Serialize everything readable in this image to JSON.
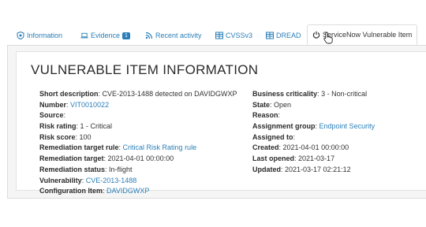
{
  "tabs": [
    {
      "label": "Information",
      "icon": "shield-bug-icon"
    },
    {
      "label": "Evidence",
      "icon": "laptop-icon",
      "badge": "1"
    },
    {
      "label": "Recent activity",
      "icon": "rss-icon"
    },
    {
      "label": "CVSSv3",
      "icon": "table-icon"
    },
    {
      "label": "DREAD",
      "icon": "table-icon"
    },
    {
      "label": "ServiceNow Vulnerable Item",
      "icon": "power-icon",
      "active": true
    }
  ],
  "card": {
    "title": "VULNERABLE ITEM INFORMATION",
    "left": [
      {
        "label": "Short description",
        "value": "CVE-2013-1488 detected on DAVIDGWXP",
        "link": false
      },
      {
        "label": "Number",
        "value": "VIT0010022",
        "link": true
      },
      {
        "label": "Source",
        "value": "",
        "link": false
      },
      {
        "label": "Risk rating",
        "value": "1 - Critical",
        "link": false
      },
      {
        "label": "Risk score",
        "value": "100",
        "link": false
      },
      {
        "label": "Remediation target rule",
        "value": "Critical Risk Rating rule",
        "link": true
      },
      {
        "label": "Remediation target",
        "value": "2021-04-01 00:00:00",
        "link": false
      },
      {
        "label": "Remediation status",
        "value": "In-flight",
        "link": false
      },
      {
        "label": "Vulnerability",
        "value": "CVE-2013-1488",
        "link": true
      },
      {
        "label": "Configuration Item",
        "value": "DAVIDGWXP",
        "link": true
      }
    ],
    "right": [
      {
        "label": "Business criticality",
        "value": "3 - Non-critical",
        "link": false
      },
      {
        "label": "State",
        "value": "Open",
        "link": false
      },
      {
        "label": "Reason",
        "value": "",
        "link": false
      },
      {
        "label": "Assignment group",
        "value": "Endpoint Security",
        "link": true
      },
      {
        "label": "Assigned to",
        "value": "",
        "link": false
      },
      {
        "label": "Created",
        "value": "2021-04-01 00:00:00",
        "link": false
      },
      {
        "label": "Last opened",
        "value": "2021-03-17",
        "link": false
      },
      {
        "label": "Updated",
        "value": "2021-03-17 02:21:12",
        "link": false
      }
    ]
  },
  "colors": {
    "link": "#2a7fb8",
    "text": "#333333",
    "border": "#dcdcdc"
  }
}
